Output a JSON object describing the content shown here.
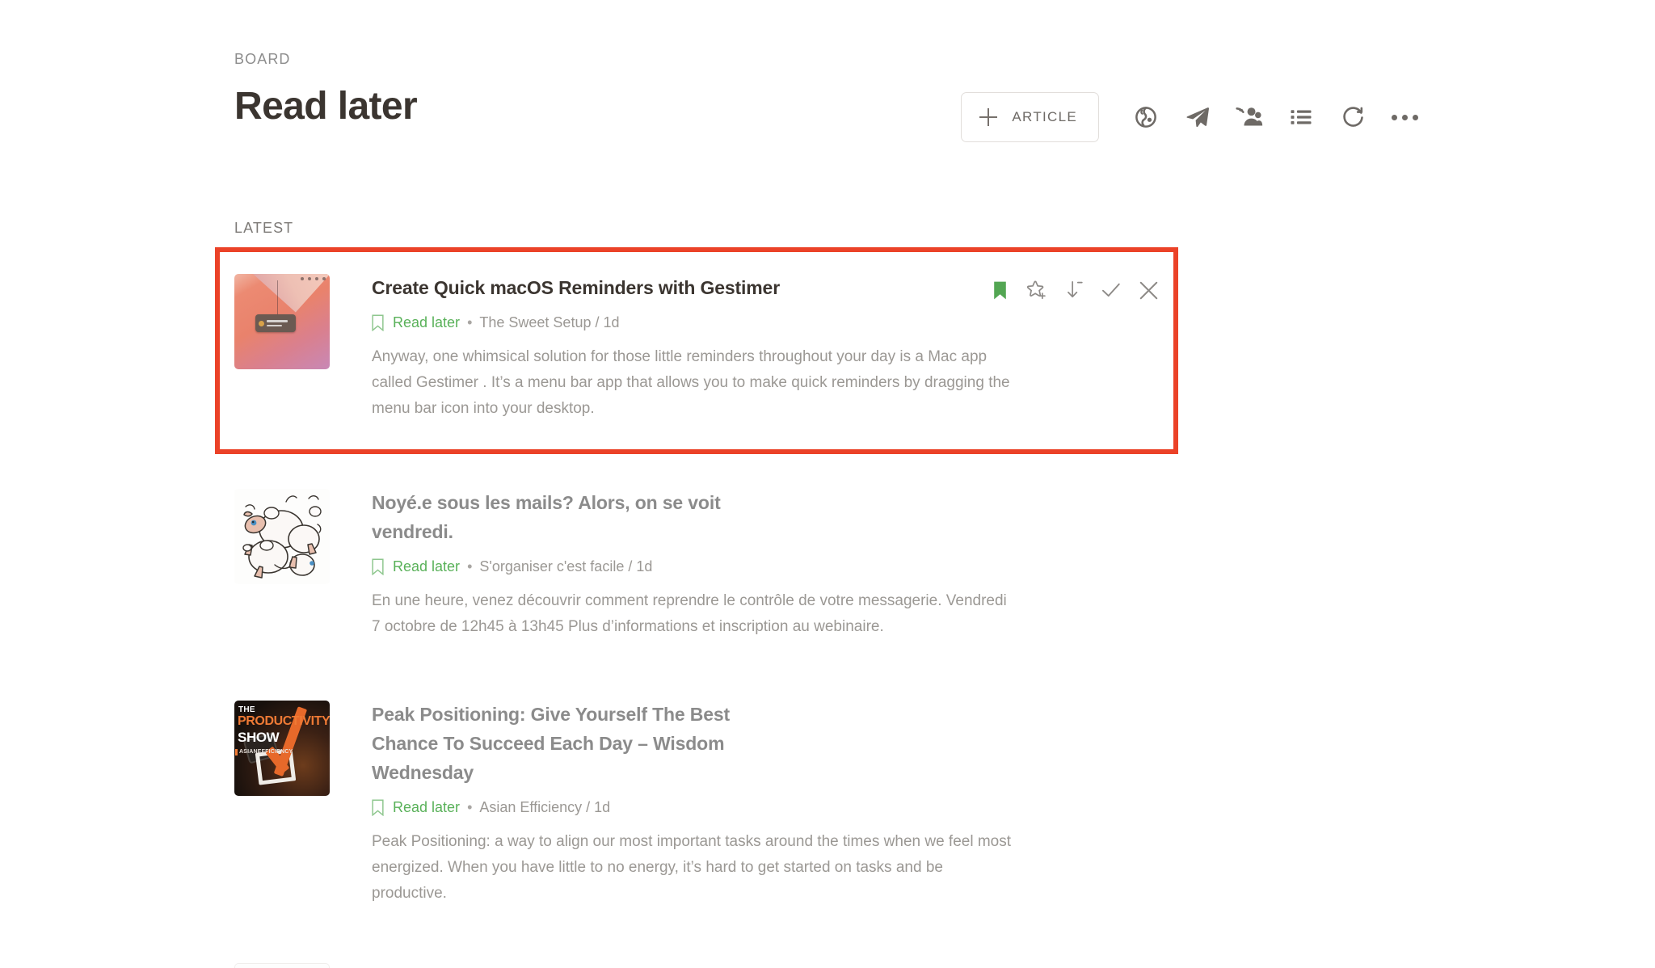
{
  "header": {
    "kicker": "BOARD",
    "title": "Read later",
    "add_button": {
      "label": "ARTICLE",
      "icon": "plus-icon"
    },
    "icons": [
      {
        "name": "globe-icon",
        "title": "Discover"
      },
      {
        "name": "paper-plane-icon",
        "title": "Send"
      },
      {
        "name": "add-people-icon",
        "title": "Invite"
      },
      {
        "name": "list-icon",
        "title": "List view"
      },
      {
        "name": "refresh-icon",
        "title": "Refresh"
      },
      {
        "name": "more-icon",
        "title": "More"
      }
    ]
  },
  "section": {
    "label": "LATEST"
  },
  "colors": {
    "highlight_red": "#eb4228",
    "board_green": "#59b159",
    "title_dark": "#3b3530",
    "title_read": "#8b8b8b",
    "muted_text": "#9b9894"
  },
  "articles": [
    {
      "title": "Create Quick macOS Reminders with Gestimer",
      "board": "Read later",
      "separator": "•",
      "source": "The Sweet Setup / 1d",
      "excerpt": "Anyway, one whimsical solution for those little reminders throughout your day is a Mac app called Gestimer . It’s a menu bar app that allows you to make quick reminders by dragging the menu bar icon into your desktop.",
      "read": false,
      "highlighted": true,
      "thumbnail": "macos-desktop-gestimer-screenshot",
      "actions": [
        {
          "name": "bookmark-icon",
          "state": "active",
          "color": "#53a653"
        },
        {
          "name": "star-plus-icon",
          "state": "inactive"
        },
        {
          "name": "download-arrow-icon",
          "state": "inactive"
        },
        {
          "name": "check-icon",
          "state": "inactive"
        },
        {
          "name": "close-icon",
          "state": "inactive"
        }
      ]
    },
    {
      "title": "Noyé.e sous les mails? Alors, on se voit vendredi.",
      "board": "Read later",
      "separator": "•",
      "source": "S'organiser c'est facile / 1d",
      "excerpt": "En une heure, venez découvrir comment reprendre le contrôle de votre messagerie. Vendredi 7 octobre de 12h45 à 13h45 Plus d’informations et inscription au webinaire.",
      "read": true,
      "highlighted": false,
      "thumbnail": "sheep-cartoon-illustration",
      "actions": []
    },
    {
      "title": "Peak Positioning: Give Yourself The Best Chance To Succeed Each Day – Wisdom Wednesday",
      "board": "Read later",
      "separator": "•",
      "source": "Asian Efficiency / 1d",
      "excerpt": "Peak Positioning: a way to align our most important tasks around the times when we feel most energized. When you have little to no energy, it’s hard to get started on tasks and be productive.",
      "read": true,
      "highlighted": false,
      "thumbnail": "productivity-show-podcast-cover",
      "thumbnail_text": {
        "line1": "THE",
        "line2": "PRODUCTIVITY",
        "line3": "SHOW",
        "line4": "ASIANEFFICIENCY"
      },
      "actions": []
    }
  ]
}
